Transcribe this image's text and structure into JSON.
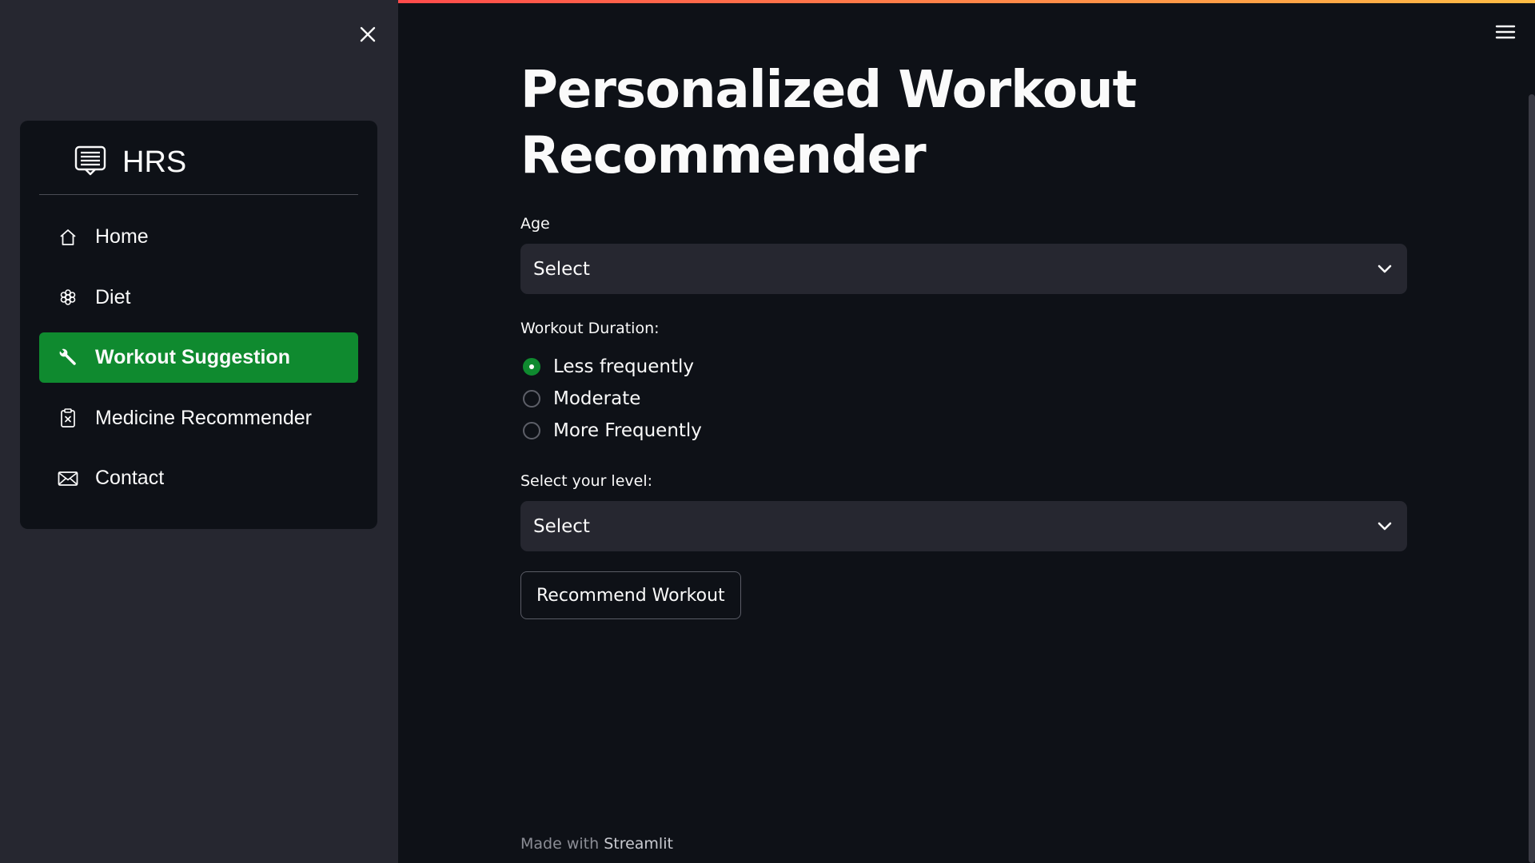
{
  "sidebar": {
    "brand": "HRS",
    "items": [
      {
        "label": "Home",
        "icon": "house-icon",
        "active": false
      },
      {
        "label": "Diet",
        "icon": "flower-icon",
        "active": false
      },
      {
        "label": "Workout Suggestion",
        "icon": "wrench-icon",
        "active": true
      },
      {
        "label": "Medicine Recommender",
        "icon": "clipboard-x-icon",
        "active": false
      },
      {
        "label": "Contact",
        "icon": "envelope-icon",
        "active": false
      }
    ]
  },
  "main": {
    "title_line1": "Personalized Workout",
    "title_line2": "Recommender",
    "age": {
      "label": "Age",
      "value": "Select"
    },
    "duration": {
      "label": "Workout Duration:",
      "options": [
        "Less frequently",
        "Moderate",
        "More Frequently"
      ],
      "selected": "Less frequently"
    },
    "level": {
      "label": "Select your level:",
      "value": "Select"
    },
    "button_label": "Recommend Workout"
  },
  "footer": {
    "prefix": "Made with ",
    "brand": "Streamlit"
  },
  "colors": {
    "background": "#0e1117",
    "sidebar": "#262730",
    "accent": "#0f8a2f",
    "deco_start": "#ff4b4b",
    "deco_end": "#ffbd45"
  }
}
